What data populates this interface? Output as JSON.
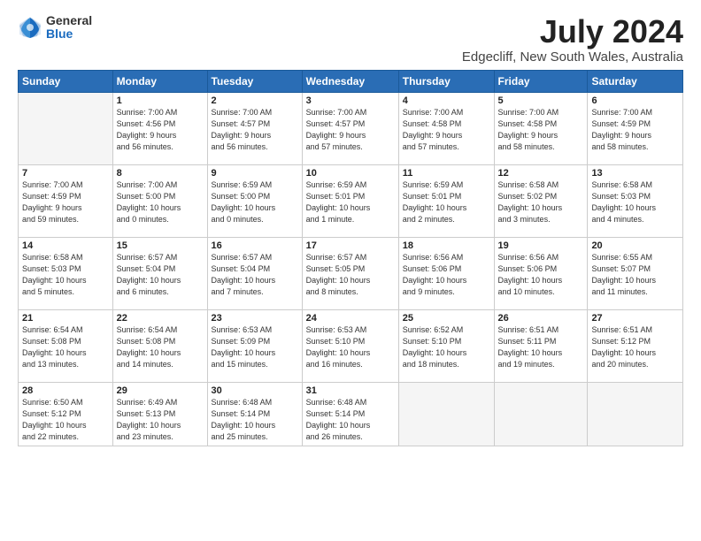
{
  "logo": {
    "general": "General",
    "blue": "Blue"
  },
  "title": "July 2024",
  "location": "Edgecliff, New South Wales, Australia",
  "days_of_week": [
    "Sunday",
    "Monday",
    "Tuesday",
    "Wednesday",
    "Thursday",
    "Friday",
    "Saturday"
  ],
  "weeks": [
    [
      {
        "day": "",
        "info": ""
      },
      {
        "day": "1",
        "info": "Sunrise: 7:00 AM\nSunset: 4:56 PM\nDaylight: 9 hours\nand 56 minutes."
      },
      {
        "day": "2",
        "info": "Sunrise: 7:00 AM\nSunset: 4:57 PM\nDaylight: 9 hours\nand 56 minutes."
      },
      {
        "day": "3",
        "info": "Sunrise: 7:00 AM\nSunset: 4:57 PM\nDaylight: 9 hours\nand 57 minutes."
      },
      {
        "day": "4",
        "info": "Sunrise: 7:00 AM\nSunset: 4:58 PM\nDaylight: 9 hours\nand 57 minutes."
      },
      {
        "day": "5",
        "info": "Sunrise: 7:00 AM\nSunset: 4:58 PM\nDaylight: 9 hours\nand 58 minutes."
      },
      {
        "day": "6",
        "info": "Sunrise: 7:00 AM\nSunset: 4:59 PM\nDaylight: 9 hours\nand 58 minutes."
      }
    ],
    [
      {
        "day": "7",
        "info": "Sunrise: 7:00 AM\nSunset: 4:59 PM\nDaylight: 9 hours\nand 59 minutes."
      },
      {
        "day": "8",
        "info": "Sunrise: 7:00 AM\nSunset: 5:00 PM\nDaylight: 10 hours\nand 0 minutes."
      },
      {
        "day": "9",
        "info": "Sunrise: 6:59 AM\nSunset: 5:00 PM\nDaylight: 10 hours\nand 0 minutes."
      },
      {
        "day": "10",
        "info": "Sunrise: 6:59 AM\nSunset: 5:01 PM\nDaylight: 10 hours\nand 1 minute."
      },
      {
        "day": "11",
        "info": "Sunrise: 6:59 AM\nSunset: 5:01 PM\nDaylight: 10 hours\nand 2 minutes."
      },
      {
        "day": "12",
        "info": "Sunrise: 6:58 AM\nSunset: 5:02 PM\nDaylight: 10 hours\nand 3 minutes."
      },
      {
        "day": "13",
        "info": "Sunrise: 6:58 AM\nSunset: 5:03 PM\nDaylight: 10 hours\nand 4 minutes."
      }
    ],
    [
      {
        "day": "14",
        "info": "Sunrise: 6:58 AM\nSunset: 5:03 PM\nDaylight: 10 hours\nand 5 minutes."
      },
      {
        "day": "15",
        "info": "Sunrise: 6:57 AM\nSunset: 5:04 PM\nDaylight: 10 hours\nand 6 minutes."
      },
      {
        "day": "16",
        "info": "Sunrise: 6:57 AM\nSunset: 5:04 PM\nDaylight: 10 hours\nand 7 minutes."
      },
      {
        "day": "17",
        "info": "Sunrise: 6:57 AM\nSunset: 5:05 PM\nDaylight: 10 hours\nand 8 minutes."
      },
      {
        "day": "18",
        "info": "Sunrise: 6:56 AM\nSunset: 5:06 PM\nDaylight: 10 hours\nand 9 minutes."
      },
      {
        "day": "19",
        "info": "Sunrise: 6:56 AM\nSunset: 5:06 PM\nDaylight: 10 hours\nand 10 minutes."
      },
      {
        "day": "20",
        "info": "Sunrise: 6:55 AM\nSunset: 5:07 PM\nDaylight: 10 hours\nand 11 minutes."
      }
    ],
    [
      {
        "day": "21",
        "info": "Sunrise: 6:54 AM\nSunset: 5:08 PM\nDaylight: 10 hours\nand 13 minutes."
      },
      {
        "day": "22",
        "info": "Sunrise: 6:54 AM\nSunset: 5:08 PM\nDaylight: 10 hours\nand 14 minutes."
      },
      {
        "day": "23",
        "info": "Sunrise: 6:53 AM\nSunset: 5:09 PM\nDaylight: 10 hours\nand 15 minutes."
      },
      {
        "day": "24",
        "info": "Sunrise: 6:53 AM\nSunset: 5:10 PM\nDaylight: 10 hours\nand 16 minutes."
      },
      {
        "day": "25",
        "info": "Sunrise: 6:52 AM\nSunset: 5:10 PM\nDaylight: 10 hours\nand 18 minutes."
      },
      {
        "day": "26",
        "info": "Sunrise: 6:51 AM\nSunset: 5:11 PM\nDaylight: 10 hours\nand 19 minutes."
      },
      {
        "day": "27",
        "info": "Sunrise: 6:51 AM\nSunset: 5:12 PM\nDaylight: 10 hours\nand 20 minutes."
      }
    ],
    [
      {
        "day": "28",
        "info": "Sunrise: 6:50 AM\nSunset: 5:12 PM\nDaylight: 10 hours\nand 22 minutes."
      },
      {
        "day": "29",
        "info": "Sunrise: 6:49 AM\nSunset: 5:13 PM\nDaylight: 10 hours\nand 23 minutes."
      },
      {
        "day": "30",
        "info": "Sunrise: 6:48 AM\nSunset: 5:14 PM\nDaylight: 10 hours\nand 25 minutes."
      },
      {
        "day": "31",
        "info": "Sunrise: 6:48 AM\nSunset: 5:14 PM\nDaylight: 10 hours\nand 26 minutes."
      },
      {
        "day": "",
        "info": ""
      },
      {
        "day": "",
        "info": ""
      },
      {
        "day": "",
        "info": ""
      }
    ]
  ]
}
